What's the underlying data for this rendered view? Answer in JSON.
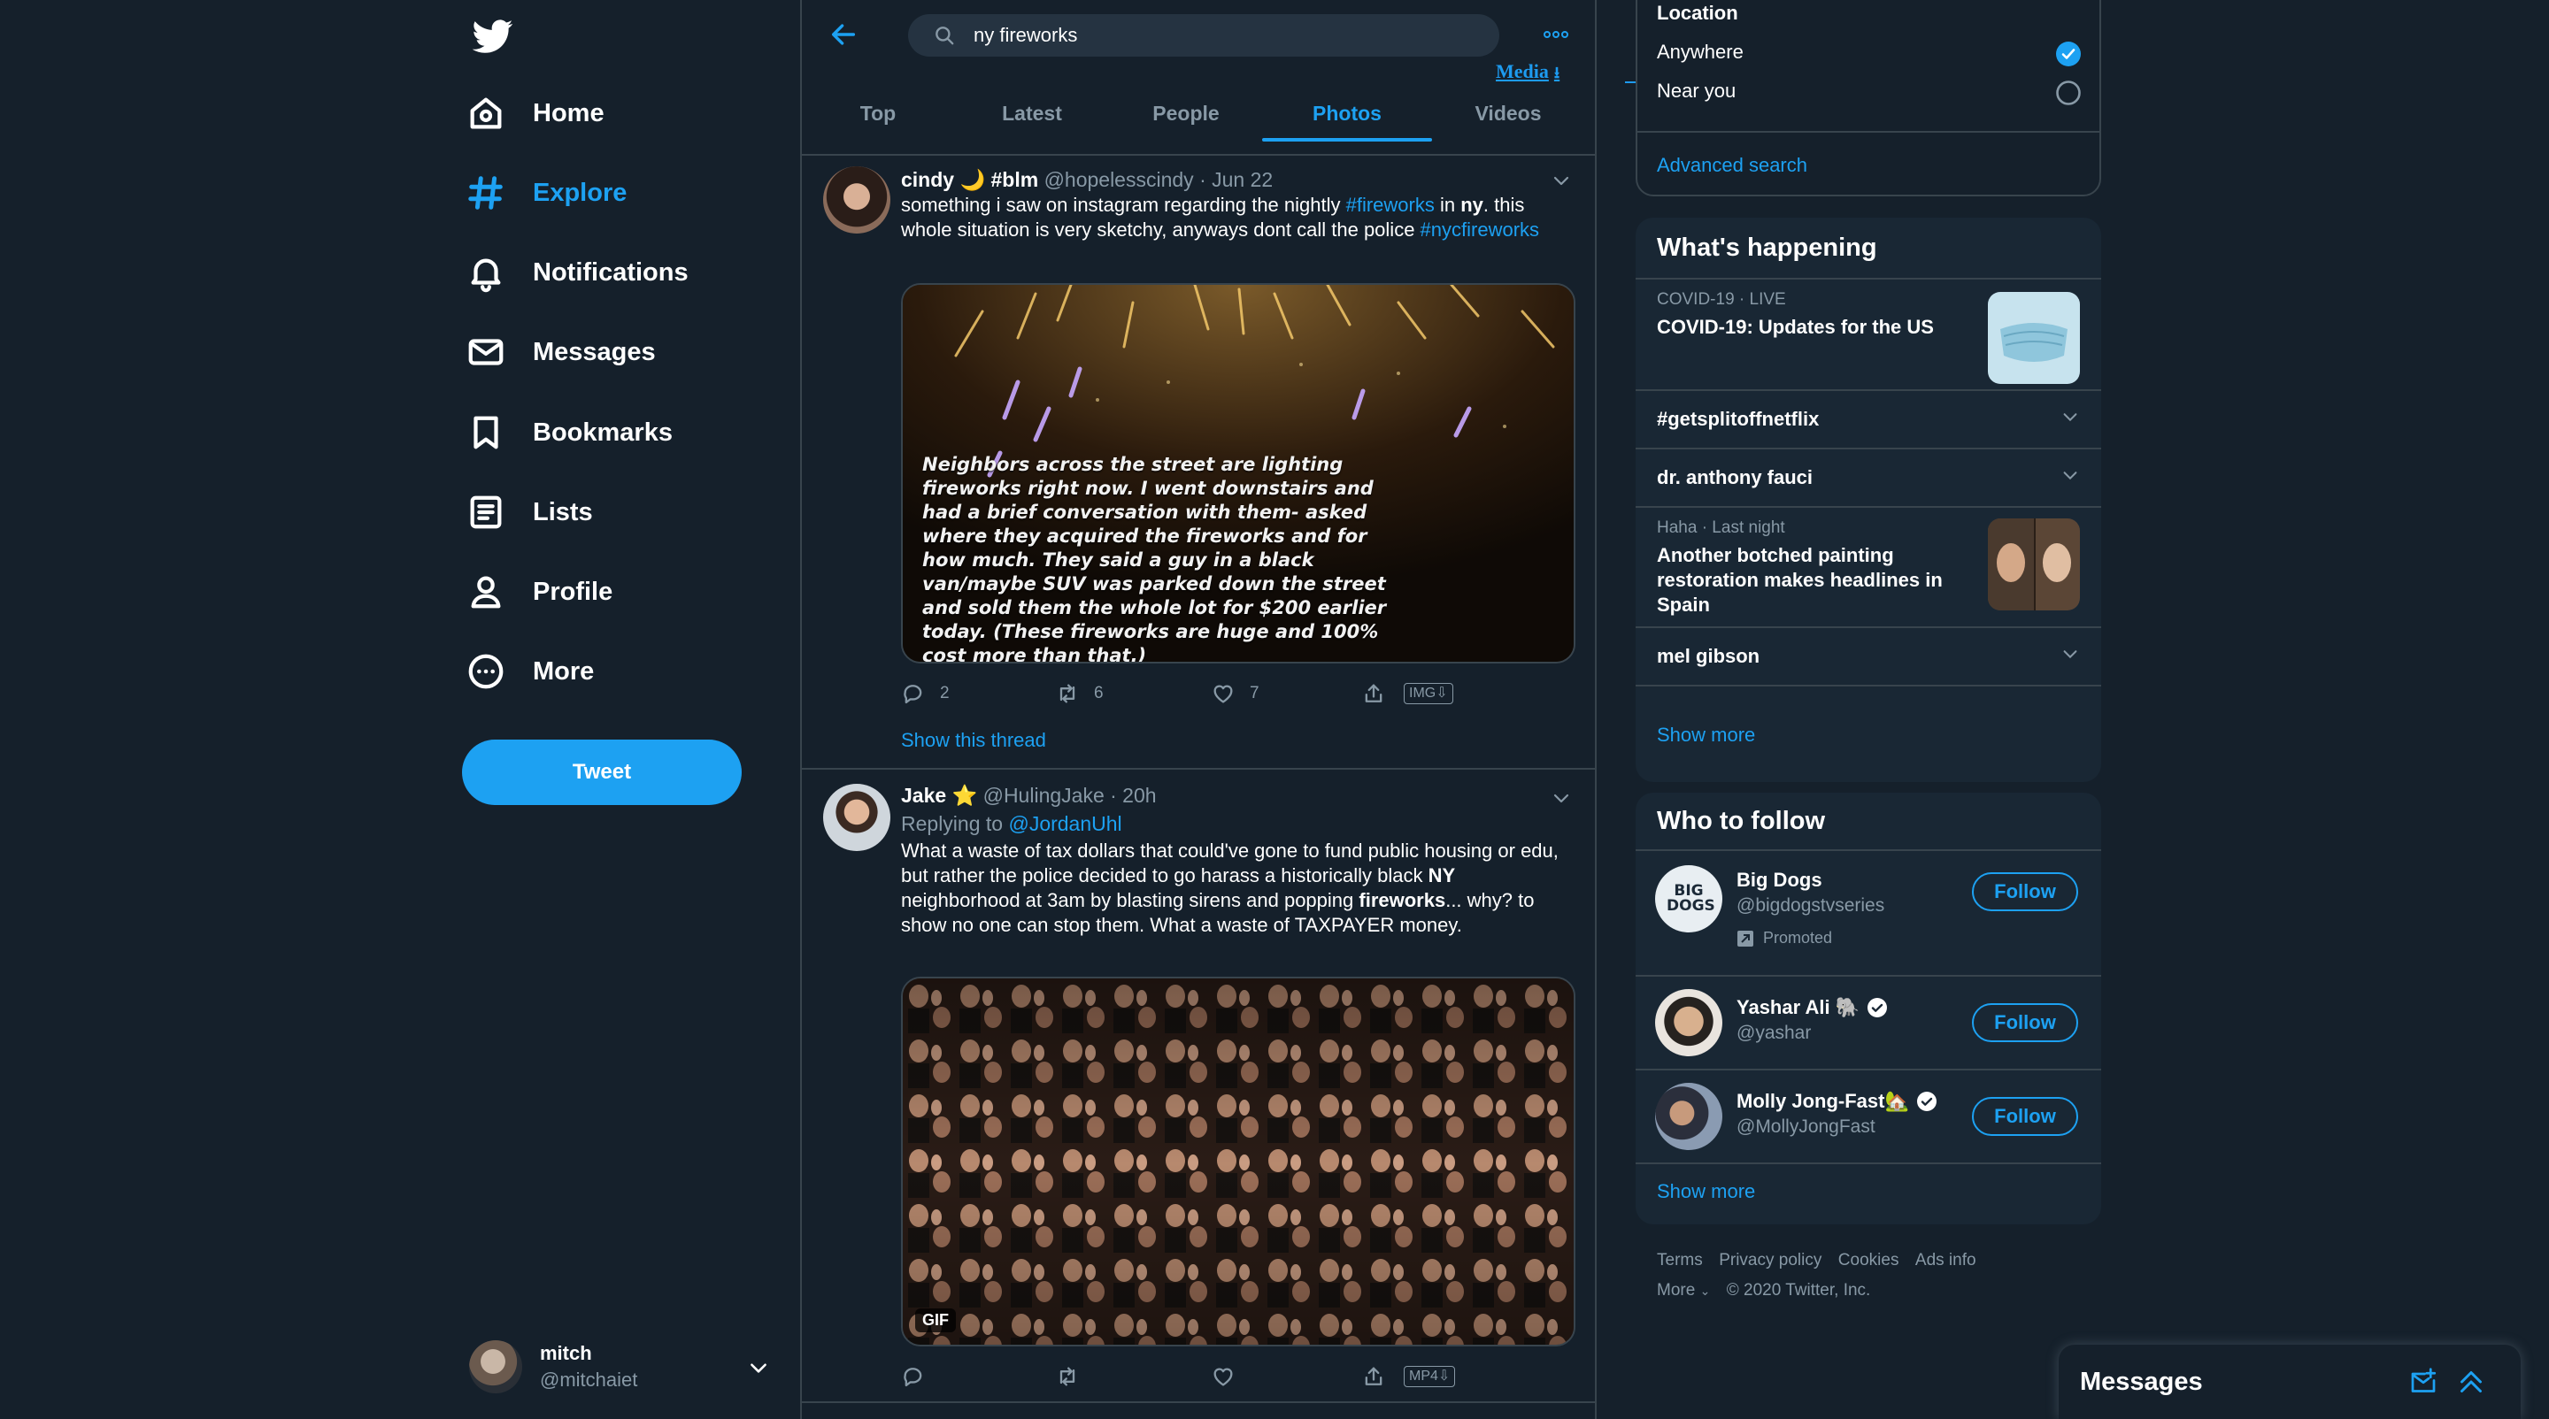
{
  "colors": {
    "background": "#15202b",
    "panel": "#192734",
    "accent": "#1da1f2",
    "muted": "#8899a6",
    "border": "#38444d"
  },
  "nav": {
    "logo_icon": "twitter-bird-icon",
    "items": [
      {
        "label": "Home",
        "icon": "home-icon"
      },
      {
        "label": "Explore",
        "icon": "hashtag-icon"
      },
      {
        "label": "Notifications",
        "icon": "bell-icon"
      },
      {
        "label": "Messages",
        "icon": "envelope-icon"
      },
      {
        "label": "Bookmarks",
        "icon": "bookmark-icon"
      },
      {
        "label": "Lists",
        "icon": "list-icon"
      },
      {
        "label": "Profile",
        "icon": "person-icon"
      },
      {
        "label": "More",
        "icon": "more-circle-icon"
      }
    ],
    "active": "Explore",
    "tweet_button": "Tweet",
    "account": {
      "name": "mitch",
      "handle": "@mitchaiet"
    }
  },
  "search": {
    "query": "ny fireworks",
    "media_link": "Media",
    "tabs": [
      "Top",
      "Latest",
      "People",
      "Photos",
      "Videos"
    ],
    "active_tab": "Photos"
  },
  "tweets": [
    {
      "name": "cindy 🌙 #blm",
      "handle": "@hopelesscindy",
      "time": "· Jun 22",
      "text": {
        "p1": "something i saw on instagram regarding the nightly ",
        "tag1": "#fireworks",
        "p2": " in ",
        "bold1": "ny",
        "p3": ". this whole situation is very sketchy, anyways dont call the police ",
        "tag2": "#nycfireworks"
      },
      "image_caption": "Neighbors across the street are lighting fireworks right now. I went downstairs and had a brief conversation with them- asked where they acquired the fireworks and for how much. They said a guy in a black van/maybe SUV was parked down the street and sold them the whole lot for $200 earlier today. (These fireworks are huge and 100% cost more than that.)",
      "replies": "2",
      "retweets": "6",
      "likes": "7",
      "download_badge": "IMG⇩",
      "show_thread": "Show this thread"
    },
    {
      "name": "Jake",
      "name_emoji": "⭐",
      "handle": "@HulingJake",
      "time": "· 20h",
      "replying_prefix": "Replying to ",
      "replying_to": "@JordanUhl",
      "text": {
        "p1": "What a waste of tax dollars that could've gone to fund public housing or edu, but rather the police decided to go harass a historically black ",
        "bold1": "NY",
        "p2": " neighborhood at 3am by blasting sirens and popping ",
        "bold2": "fireworks",
        "p3": "... why? to show no one can stop them. What a waste of TAXPAYER money."
      },
      "gif_label": "GIF",
      "download_badge": "MP4⇩"
    }
  ],
  "location": {
    "title": "Location",
    "options": [
      {
        "label": "Anywhere",
        "selected": true
      },
      {
        "label": "Near you",
        "selected": false
      }
    ],
    "advanced_search": "Advanced search"
  },
  "whats_happening": {
    "title": "What's happening",
    "covid": {
      "meta": "COVID-19 · LIVE",
      "title": "COVID-19: Updates for the US"
    },
    "trends": [
      "#getsplitoffnetflix",
      "dr. anthony fauci"
    ],
    "story": {
      "meta": "Haha · Last night",
      "title": "Another botched painting restoration makes headlines in Spain"
    },
    "trend_last": "mel gibson",
    "show_more": "Show more"
  },
  "who_to_follow": {
    "title": "Who to follow",
    "users": [
      {
        "name": "Big Dogs",
        "handle": "@bigdogstvseries",
        "promoted": "Promoted",
        "avatar_text": "BIG DOGS"
      },
      {
        "name": "Yashar Ali 🐘",
        "handle": "@yashar",
        "verified": true
      },
      {
        "name": "Molly Jong-Fast🏡",
        "handle": "@MollyJongFast",
        "verified": true
      }
    ],
    "follow_label": "Follow",
    "show_more": "Show more"
  },
  "footer": {
    "links": [
      "Terms",
      "Privacy policy",
      "Cookies",
      "Ads info"
    ],
    "more": "More",
    "copyright": "© 2020 Twitter, Inc."
  },
  "messages_drawer": {
    "title": "Messages"
  }
}
